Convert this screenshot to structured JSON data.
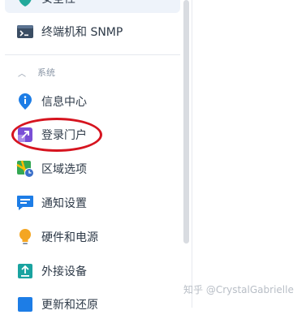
{
  "sidebar": {
    "items": [
      {
        "name": "security",
        "label": "安全性",
        "icon": "shield-icon",
        "selected": true
      },
      {
        "name": "terminal-snmp",
        "label": "终端机和 SNMP",
        "icon": "terminal-icon"
      },
      {
        "name": "info-center",
        "label": "信息中心",
        "icon": "info-icon"
      },
      {
        "name": "login-portal",
        "label": "登录门户",
        "icon": "login-portal-icon"
      },
      {
        "name": "regional-options",
        "label": "区域选项",
        "icon": "region-clock-icon"
      },
      {
        "name": "notification",
        "label": "通知设置",
        "icon": "notification-icon"
      },
      {
        "name": "hardware-power",
        "label": "硬件和电源",
        "icon": "bulb-icon"
      },
      {
        "name": "external-devices",
        "label": "外接设备",
        "icon": "external-device-icon"
      },
      {
        "name": "update-restore",
        "label": "更新和还原",
        "icon": "update-icon"
      }
    ],
    "section": {
      "label": "系统",
      "icon": "chevron-up-icon"
    }
  },
  "annotation": {
    "color": "#d6141f",
    "target": "登录门户"
  },
  "watermark": {
    "text": "知乎 @CrystalGabrielle"
  }
}
